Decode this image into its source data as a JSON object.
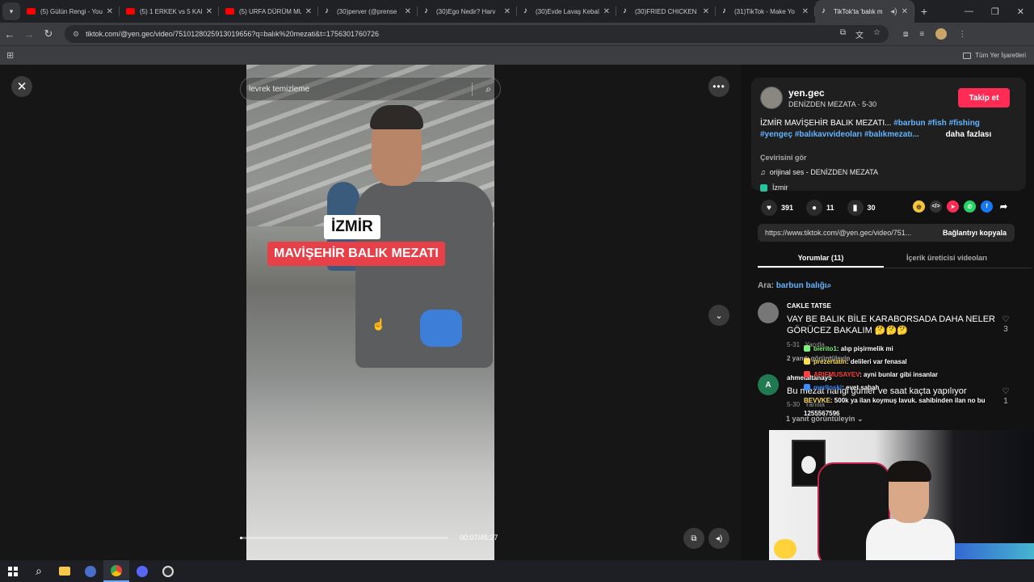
{
  "browser": {
    "tabs": [
      {
        "title": "(5) Gülün Rengi - You",
        "favicon": "youtube-icon",
        "active": false
      },
      {
        "title": "(5) 1 ERKEK vs 5 KADI",
        "favicon": "youtube-icon",
        "active": false
      },
      {
        "title": "(5) URFA DÜRÜM MU",
        "favicon": "youtube-icon",
        "active": false
      },
      {
        "title": "(30)perver (@prense",
        "favicon": "tiktok-icon",
        "active": false
      },
      {
        "title": "(30)Ego Nedir? Harv",
        "favicon": "tiktok-icon",
        "active": false
      },
      {
        "title": "(30)Evde Lavaş Kebal",
        "favicon": "tiktok-icon",
        "active": false
      },
      {
        "title": "(30)FRIED CHICKEN I",
        "favicon": "tiktok-icon",
        "active": false
      },
      {
        "title": "(31)TikTok - Make Yo",
        "favicon": "tiktok-icon",
        "active": false
      },
      {
        "title": "TikTok'ta 'balık m",
        "favicon": "tiktok-icon",
        "active": true
      }
    ],
    "url": "tiktok.com/@yen.gec/video/7510128025913019656?q=balık%20mezati&t=1756301760726",
    "bookmarks_folder": "Tüm Yer İşaretleri"
  },
  "video": {
    "search_text": "levrek temizleme",
    "overlay_title": "İZMİR",
    "overlay_subtitle": "MAVİŞEHİR BALIK MEZATI",
    "time": "00:07/45:27",
    "progress": 0.003
  },
  "author": {
    "username": "yen.gec",
    "display_name_date": "DENİZDEN MEZATA · 5-30",
    "follow_label": "Takip et",
    "desc_text": "İZMİR MAVİŞEHİR BALIK MEZATI...",
    "hashtags_line1": [
      "#barbun",
      "#fish",
      "#fishing"
    ],
    "hashtags_line2": [
      "#yengeç",
      "#balıkavıvideoları",
      "#balıkmezatı..."
    ],
    "more_label": "daha fazlası",
    "translate_label": "Çevirisini gör",
    "music": "orijinal ses - DENİZDEN MEZATA",
    "location": "İzmir"
  },
  "stats": {
    "likes": "391",
    "comments": "11",
    "saves": "30"
  },
  "share": {
    "link": "https://www.tiktok.com/@yen.gec/video/751...",
    "copy_label": "Bağlantıyı kopyala"
  },
  "side_tabs": {
    "comments": "Yorumlar (11)",
    "creator_videos": "İçerik üreticisi videoları"
  },
  "search_hint": {
    "prefix": "Ara:",
    "keyword": "barbun balığı"
  },
  "comments": [
    {
      "user": "CAKLE TATSE",
      "text": "VAY BE BALIK BİLE KARABORSADA DAHA NELER GÖRÜCEZ BAKALIM 🤔🤔🤔",
      "date": "5-31",
      "reply": "Yanıtla",
      "likes": "3",
      "replies": "2 yanıtı görüntüleyin"
    },
    {
      "user": "ahmetaltanay5",
      "avatar_letter": "A",
      "text": "Bu mezat hangi günler ve saat kaçta yapılıyor",
      "date": "5-30",
      "reply": "Yanıtla",
      "likes": "1",
      "replies": "1 yanıt görüntüleyin"
    }
  ],
  "stream_chat": [
    {
      "name": "bierito1",
      "msg": ": alıp pişirmelik mi"
    },
    {
      "name": "prezertatin",
      "msg": ": delileri var fenasal"
    },
    {
      "name": "ARIFMUSAYEV",
      "msg": ": ayni bunlar gibi insanlar"
    },
    {
      "name": "merlloski",
      "msg": ": evet sabah"
    },
    {
      "name": "BEVVKE",
      "msg": ": 500k ya ilan koymuş lavuk. sahibinden ilan no bu"
    },
    {
      "name": "",
      "msg": "1255567596"
    }
  ]
}
